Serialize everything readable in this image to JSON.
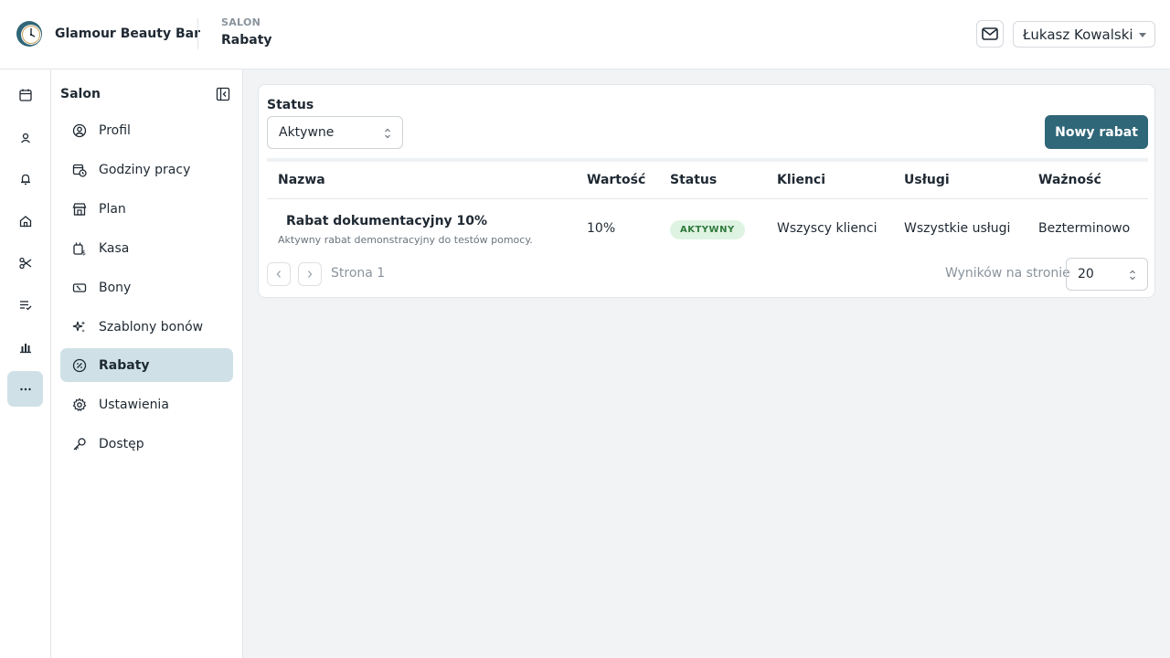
{
  "header": {
    "brand": "Glamour Beauty Bar",
    "section": "SALON",
    "page": "Rabaty",
    "user": "Łukasz Kowalski"
  },
  "rail": {
    "icons": [
      "calendar-icon",
      "client-icon",
      "bell-icon",
      "home-icon",
      "scissors-icon",
      "checklist-icon",
      "chart-icon",
      "more-icon"
    ],
    "active": "more-icon"
  },
  "sidebar": {
    "title": "Salon",
    "items": [
      {
        "label": "Profil",
        "icon": "user-circle-icon"
      },
      {
        "label": "Godziny pracy",
        "icon": "calendar-clock-icon"
      },
      {
        "label": "Plan",
        "icon": "store-icon"
      },
      {
        "label": "Kasa",
        "icon": "cash-register-icon"
      },
      {
        "label": "Bony",
        "icon": "voucher-icon"
      },
      {
        "label": "Szablony bonów",
        "icon": "sparkles-icon"
      },
      {
        "label": "Rabaty",
        "icon": "discount-icon"
      },
      {
        "label": "Ustawienia",
        "icon": "gear-icon"
      },
      {
        "label": "Dostęp",
        "icon": "key-icon"
      }
    ],
    "active": "Rabaty"
  },
  "filter": {
    "label": "Status",
    "value": "Aktywne"
  },
  "toolbar": {
    "new_label": "Nowy rabat"
  },
  "table": {
    "headers": [
      "Nazwa",
      "Wartość",
      "Status",
      "Klienci",
      "Usługi",
      "Ważność"
    ],
    "rows": [
      {
        "name": "Rabat dokumentacyjny 10%",
        "description": "Aktywny rabat demonstracyjny do testów pomocy.",
        "value": "10%",
        "status": "AKTYWNY",
        "clients": "Wszyscy klienci",
        "services": "Wszystkie usługi",
        "validity": "Bezterminowo"
      }
    ]
  },
  "pagination": {
    "page_label": "Strona 1",
    "per_page_label": "Wyników na stronie",
    "per_page_value": "20"
  },
  "colors": {
    "accent": "#2f6678",
    "active_bg": "#cfe1e7",
    "badge_bg": "#dff3e2",
    "badge_text": "#2f7a3c"
  }
}
